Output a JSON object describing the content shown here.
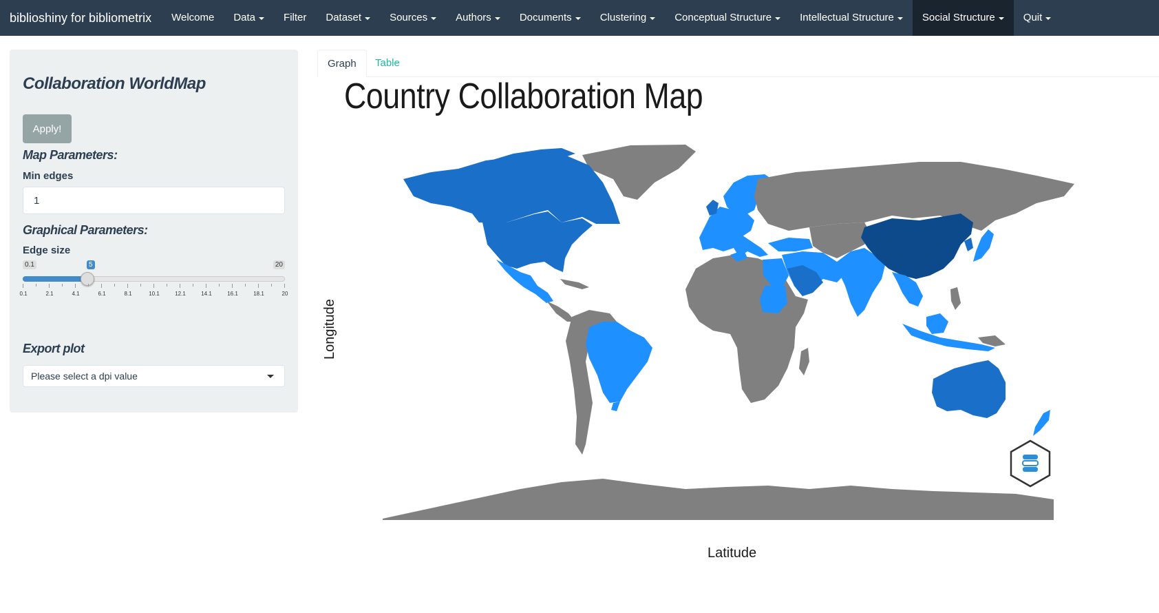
{
  "navbar": {
    "brand": "biblioshiny for bibliometrix",
    "items": [
      {
        "label": "Welcome",
        "dropdown": false,
        "active": false
      },
      {
        "label": "Data",
        "dropdown": true,
        "active": false
      },
      {
        "label": "Filter",
        "dropdown": false,
        "active": false
      },
      {
        "label": "Dataset",
        "dropdown": true,
        "active": false
      },
      {
        "label": "Sources",
        "dropdown": true,
        "active": false
      },
      {
        "label": "Authors",
        "dropdown": true,
        "active": false
      },
      {
        "label": "Documents",
        "dropdown": true,
        "active": false
      },
      {
        "label": "Clustering",
        "dropdown": true,
        "active": false
      },
      {
        "label": "Conceptual Structure",
        "dropdown": true,
        "active": false
      },
      {
        "label": "Intellectual Structure",
        "dropdown": true,
        "active": false
      },
      {
        "label": "Social Structure",
        "dropdown": true,
        "active": true
      },
      {
        "label": "Quit",
        "dropdown": true,
        "active": false
      }
    ]
  },
  "sidebar": {
    "title": "Collaboration WorldMap",
    "apply_label": "Apply!",
    "map_params_title": "Map Parameters:",
    "min_edges_label": "Min edges",
    "min_edges_value": "1",
    "graph_params_title": "Graphical Parameters:",
    "edge_size_label": "Edge size",
    "edge_size": {
      "min": "0.1",
      "max": "20",
      "value": "5",
      "value_num": 5,
      "min_num": 0.1,
      "max_num": 20,
      "tick_labels": [
        "0.1",
        "2.1",
        "4.1",
        "6.1",
        "8.1",
        "10.1",
        "12.1",
        "14.1",
        "16.1",
        "18.1",
        "20"
      ]
    },
    "export_title": "Export plot",
    "dpi_placeholder": "Please select a dpi value"
  },
  "tabs": [
    {
      "label": "Graph",
      "active": true
    },
    {
      "label": "Table",
      "active": false
    }
  ],
  "plot": {
    "title": "Country Collaboration Map",
    "x_label": "Latitude",
    "y_label": "Longitude"
  },
  "colors": {
    "navbar": "#2c3e50",
    "active_nav": "#1a242f",
    "tab_link": "#18bc9c",
    "land_no_data": "#808080",
    "collab_low": "#1e90ff",
    "collab_mid": "#1a6fc9",
    "collab_high": "#0d4a8c"
  }
}
